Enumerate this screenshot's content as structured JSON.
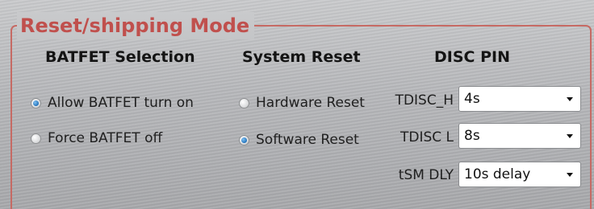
{
  "group": {
    "title": "Reset/shipping Mode"
  },
  "batfet": {
    "heading": "BATFET Selection",
    "options": [
      {
        "label": "Allow BATFET turn on",
        "selected": true
      },
      {
        "label": "Force BATFET off",
        "selected": false
      }
    ]
  },
  "system_reset": {
    "heading": "System Reset",
    "options": [
      {
        "label": "Hardware Reset",
        "selected": false
      },
      {
        "label": "Software Reset",
        "selected": true
      }
    ]
  },
  "disc_pin": {
    "heading": "DISC PIN",
    "fields": [
      {
        "label": "TDISC_H",
        "value": "4s"
      },
      {
        "label": "TDISC L",
        "value": "8s"
      },
      {
        "label": "tSM DLY",
        "value": "10s delay"
      }
    ]
  },
  "colors": {
    "group_title": "#c0504d",
    "frame": "#c66a64",
    "radio_selected": "#1f6fb8"
  }
}
